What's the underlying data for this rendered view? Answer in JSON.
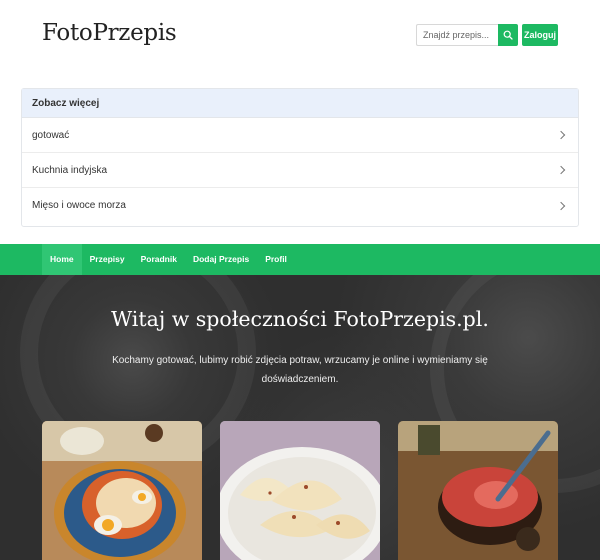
{
  "header": {
    "logo": "FotoPrzepis",
    "search_placeholder": "Znajdź przepis...",
    "login_label": "Zaloguj"
  },
  "more": {
    "title": "Zobacz więcej",
    "items": [
      {
        "label": "gotować"
      },
      {
        "label": "Kuchnia indyjska"
      },
      {
        "label": "Mięso i owoce morza"
      }
    ]
  },
  "nav": {
    "items": [
      {
        "label": "Home",
        "active": true
      },
      {
        "label": "Przepisy"
      },
      {
        "label": "Poradnik"
      },
      {
        "label": "Dodaj Przepis"
      },
      {
        "label": "Profil"
      }
    ]
  },
  "hero": {
    "title": "Witaj w społeczności FotoPrzepis.pl.",
    "subtitle": "Kochamy gotować, lubimy robić zdjęcia potraw, wrzucamy je online i wymieniamy się doświadczeniem."
  },
  "colors": {
    "accent": "#1db962",
    "nav_active": "#30c674",
    "more_header_bg": "#e9f0fb"
  },
  "icons": {
    "search": "search-icon",
    "chevron": "chevron-right-icon"
  }
}
